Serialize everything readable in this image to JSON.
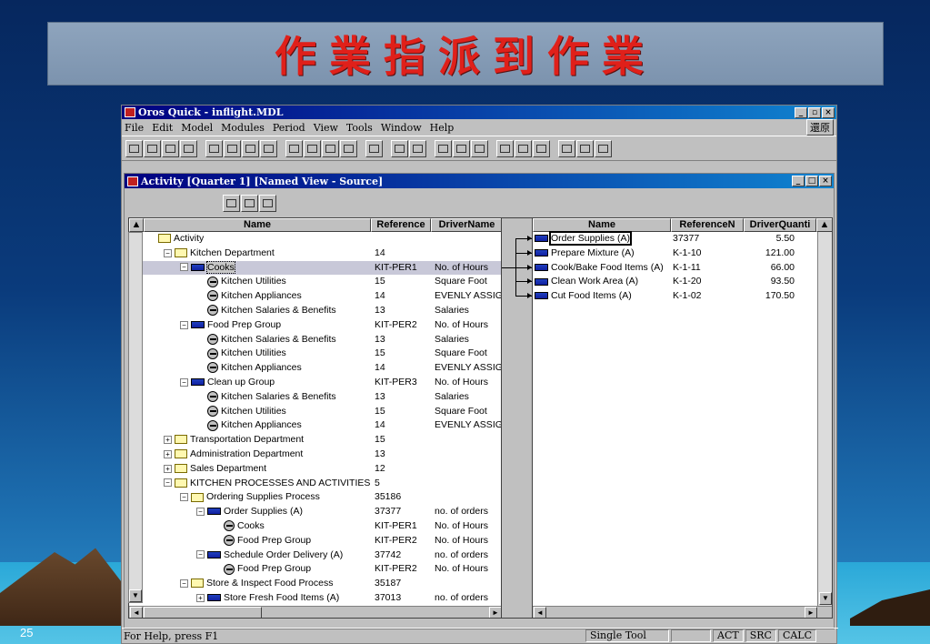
{
  "slide": {
    "title": "作業指派到作業",
    "number": "25"
  },
  "app": {
    "title": "Oros Quick - inflight.MDL",
    "menu": [
      "File",
      "Edit",
      "Model",
      "Modules",
      "Period",
      "View",
      "Tools",
      "Window",
      "Help"
    ],
    "restore_label": "還原",
    "toolbar_icons": [
      "new-icon",
      "open-icon",
      "save-icon",
      "print-icon",
      "cut-icon",
      "copy-icon",
      "paste-icon",
      "paste-special-icon",
      "new-item-icon",
      "new-child-icon",
      "edit-icon",
      "delete-icon",
      "assign-icon",
      "tree-icon",
      "split-icon",
      "calc-icon",
      "run-icon",
      "view-icon",
      "bulb-icon",
      "report-icon",
      "report2-icon",
      "report3-icon",
      "grid-icon",
      "help-icon"
    ]
  },
  "child": {
    "title": "Activity [Quarter 1] [Named View - Source]",
    "left_headers": {
      "name": "Name",
      "reference": "Reference",
      "driver": "DriverName"
    },
    "right_headers": {
      "name": "Name",
      "reference": "ReferenceN",
      "qty": "DriverQuanti"
    },
    "left_rows": [
      {
        "indent": 0,
        "pm": "",
        "icon": "folder",
        "name": "Activity",
        "ref": "",
        "driver": ""
      },
      {
        "indent": 1,
        "pm": "−",
        "icon": "folder",
        "name": "Kitchen Department",
        "ref": "14",
        "driver": ""
      },
      {
        "indent": 2,
        "pm": "−",
        "icon": "act",
        "name": "Cooks",
        "ref": "KIT-PER1",
        "driver": "No. of Hours",
        "selected": true
      },
      {
        "indent": 3,
        "pm": "",
        "icon": "drv",
        "name": "Kitchen Utilities",
        "ref": "15",
        "driver": "Square Foot"
      },
      {
        "indent": 3,
        "pm": "",
        "icon": "drv",
        "name": "Kitchen Appliances",
        "ref": "14",
        "driver": "EVENLY ASSIG"
      },
      {
        "indent": 3,
        "pm": "",
        "icon": "drv",
        "name": "Kitchen Salaries & Benefits",
        "ref": "13",
        "driver": "Salaries"
      },
      {
        "indent": 2,
        "pm": "−",
        "icon": "act",
        "name": "Food Prep Group",
        "ref": "KIT-PER2",
        "driver": "No. of Hours"
      },
      {
        "indent": 3,
        "pm": "",
        "icon": "drv",
        "name": "Kitchen Salaries & Benefits",
        "ref": "13",
        "driver": "Salaries"
      },
      {
        "indent": 3,
        "pm": "",
        "icon": "drv",
        "name": "Kitchen Utilities",
        "ref": "15",
        "driver": "Square Foot"
      },
      {
        "indent": 3,
        "pm": "",
        "icon": "drv",
        "name": "Kitchen Appliances",
        "ref": "14",
        "driver": "EVENLY ASSIG"
      },
      {
        "indent": 2,
        "pm": "−",
        "icon": "act",
        "name": "Clean up Group",
        "ref": "KIT-PER3",
        "driver": "No. of Hours"
      },
      {
        "indent": 3,
        "pm": "",
        "icon": "drv",
        "name": "Kitchen Salaries & Benefits",
        "ref": "13",
        "driver": "Salaries"
      },
      {
        "indent": 3,
        "pm": "",
        "icon": "drv",
        "name": "Kitchen Utilities",
        "ref": "15",
        "driver": "Square Foot"
      },
      {
        "indent": 3,
        "pm": "",
        "icon": "drv",
        "name": "Kitchen Appliances",
        "ref": "14",
        "driver": "EVENLY ASSIG"
      },
      {
        "indent": 1,
        "pm": "+",
        "icon": "folder",
        "name": "Transportation Department",
        "ref": "15",
        "driver": ""
      },
      {
        "indent": 1,
        "pm": "+",
        "icon": "folder",
        "name": "Administration Department",
        "ref": "13",
        "driver": ""
      },
      {
        "indent": 1,
        "pm": "+",
        "icon": "folder",
        "name": "Sales Department",
        "ref": "12",
        "driver": ""
      },
      {
        "indent": 1,
        "pm": "−",
        "icon": "folder",
        "name": "KITCHEN PROCESSES AND ACTIVITIES",
        "ref": "5",
        "driver": ""
      },
      {
        "indent": 2,
        "pm": "−",
        "icon": "folder",
        "name": "Ordering Supplies Process",
        "ref": "35186",
        "driver": ""
      },
      {
        "indent": 3,
        "pm": "−",
        "icon": "act",
        "name": "Order Supplies (A)",
        "ref": "37377",
        "driver": "no. of orders"
      },
      {
        "indent": 4,
        "pm": "",
        "icon": "drv",
        "name": "Cooks",
        "ref": "KIT-PER1",
        "driver": "No. of Hours"
      },
      {
        "indent": 4,
        "pm": "",
        "icon": "drv",
        "name": "Food Prep Group",
        "ref": "KIT-PER2",
        "driver": "No. of Hours"
      },
      {
        "indent": 3,
        "pm": "−",
        "icon": "act",
        "name": "Schedule Order Delivery (A)",
        "ref": "37742",
        "driver": "no. of orders"
      },
      {
        "indent": 4,
        "pm": "",
        "icon": "drv",
        "name": "Food Prep Group",
        "ref": "KIT-PER2",
        "driver": "No. of Hours"
      },
      {
        "indent": 2,
        "pm": "−",
        "icon": "folder",
        "name": "Store & Inspect Food Process",
        "ref": "35187",
        "driver": ""
      },
      {
        "indent": 3,
        "pm": "+",
        "icon": "act",
        "name": "Store Fresh Food Items (A)",
        "ref": "37013",
        "driver": "no. of orders"
      }
    ],
    "right_rows": [
      {
        "name": "Order Supplies (A)",
        "ref": "37377",
        "qty": "5.50",
        "selected": true
      },
      {
        "name": "Prepare Mixture (A)",
        "ref": "K-1-10",
        "qty": "121.00"
      },
      {
        "name": "Cook/Bake Food Items (A)",
        "ref": "K-1-11",
        "qty": "66.00"
      },
      {
        "name": "Clean Work Area (A)",
        "ref": "K-1-20",
        "qty": "93.50"
      },
      {
        "name": "Cut Food Items (A)",
        "ref": "K-1-02",
        "qty": "170.50"
      }
    ]
  },
  "status": {
    "help": "For Help, press F1",
    "mode": "Single Tool",
    "act": "ACT",
    "src": "SRC",
    "calc": "CALC"
  }
}
